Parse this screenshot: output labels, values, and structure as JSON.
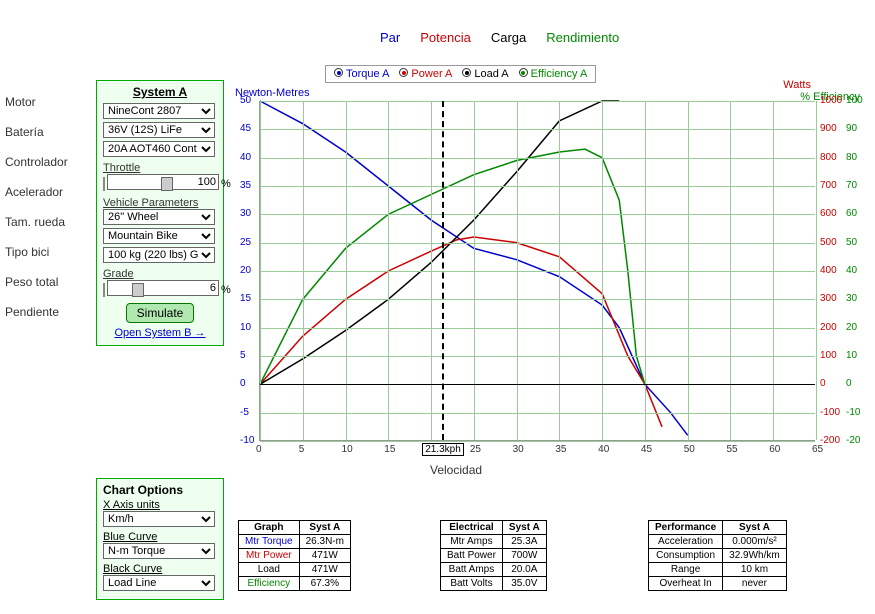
{
  "top": {
    "par": "Par",
    "potencia": "Potencia",
    "carga": "Carga",
    "rend": "Rendimiento"
  },
  "side": {
    "motor": "Motor",
    "bateria": "Batería",
    "control": "Controlador",
    "acel": "Acelerador",
    "rueda": "Tam. rueda",
    "bici": "Tipo bici",
    "peso": "Peso total",
    "pend": "Pendiente"
  },
  "sysA": {
    "title": "System A",
    "motor": "NineCont 2807",
    "battery": "36V (12S) LiFe",
    "controller": "20A AOT460 Cont",
    "throttle_lbl": "Throttle",
    "throttle_val": "100",
    "throttle_pct": "%",
    "veh_lbl": "Vehicle Parameters",
    "wheel": "26\" Wheel",
    "bike": "Mountain Bike",
    "weight": "100 kg (220 lbs) G",
    "grade_lbl": "Grade",
    "grade_val": "6",
    "grade_pct": "%",
    "simulate": "Simulate",
    "openB": "Open System B →"
  },
  "chartopts": {
    "title": "Chart Options",
    "xunits_lbl": "X Axis units",
    "xunits": "Km/h",
    "blue_lbl": "Blue Curve",
    "blue": "N-m Torque",
    "black_lbl": "Black Curve",
    "black": "Load Line"
  },
  "legend": {
    "torque": "Torque A",
    "power": "Power A",
    "load": "Load A",
    "eff": "Efficiency A"
  },
  "axes": {
    "yleft": "Newton-Metres",
    "yright1": "Watts",
    "yright2": "% Efficiency",
    "xlab": "Velocidad",
    "cursor": "21.3kph"
  },
  "chart_data": {
    "type": "line",
    "xlabel": "Velocidad (kph)",
    "xlim": [
      0,
      65
    ],
    "y_left": {
      "label": "Newton-Metres",
      "lim": [
        -10,
        50
      ]
    },
    "y_right_watts": {
      "label": "Watts",
      "lim": [
        -200,
        1000
      ]
    },
    "y_right_eff": {
      "label": "% Efficiency",
      "lim": [
        -20,
        100
      ]
    },
    "cursor_x": 21.3,
    "series": [
      {
        "name": "Torque A",
        "axis": "y_left",
        "color": "#00c",
        "x": [
          0,
          5,
          10,
          15,
          20,
          25,
          30,
          35,
          40,
          42,
          45,
          48,
          50
        ],
        "y": [
          50,
          46,
          41,
          35,
          29,
          24,
          22,
          19,
          14,
          10,
          0,
          -5,
          -9
        ]
      },
      {
        "name": "Power A",
        "axis": "y_right_watts",
        "color": "#c00",
        "x": [
          0,
          5,
          10,
          15,
          20,
          23,
          25,
          30,
          35,
          40,
          43,
          45,
          47
        ],
        "y": [
          0,
          170,
          300,
          400,
          470,
          510,
          520,
          500,
          450,
          320,
          100,
          0,
          -150
        ]
      },
      {
        "name": "Load A",
        "axis": "y_right_watts",
        "color": "#000",
        "x": [
          0,
          5,
          10,
          15,
          20,
          25,
          30,
          35,
          40,
          42
        ],
        "y": [
          0,
          90,
          190,
          300,
          430,
          580,
          750,
          930,
          1000,
          1000
        ]
      },
      {
        "name": "Efficiency A",
        "axis": "y_right_eff",
        "color": "#080",
        "x": [
          0,
          5,
          10,
          15,
          20,
          25,
          30,
          35,
          38,
          40,
          42,
          43,
          44,
          45
        ],
        "y": [
          0,
          30,
          48,
          60,
          67,
          74,
          79,
          82,
          83,
          80,
          65,
          40,
          10,
          0
        ]
      }
    ]
  },
  "tables": {
    "graph": {
      "h1": "Graph",
      "h2": "Syst A",
      "rows": [
        {
          "k": "Mtr Torque",
          "v": "26.3N-m",
          "cls": "row-torque"
        },
        {
          "k": "Mtr Power",
          "v": "471W",
          "cls": "row-power"
        },
        {
          "k": "Load",
          "v": "471W",
          "cls": ""
        },
        {
          "k": "Efficiency",
          "v": "67.3%",
          "cls": "row-eff"
        }
      ]
    },
    "elec": {
      "h1": "Electrical",
      "h2": "Syst A",
      "rows": [
        {
          "k": "Mtr Amps",
          "v": "25.3A"
        },
        {
          "k": "Batt Power",
          "v": "700W"
        },
        {
          "k": "Batt Amps",
          "v": "20.0A"
        },
        {
          "k": "Batt Volts",
          "v": "35.0V"
        }
      ]
    },
    "perf": {
      "h1": "Performance",
      "h2": "Syst A",
      "rows": [
        {
          "k": "Acceleration",
          "v": "0.000m/s²"
        },
        {
          "k": "Consumption",
          "v": "32.9Wh/km"
        },
        {
          "k": "Range",
          "v": "10 km"
        },
        {
          "k": "Overheat In",
          "v": "never"
        }
      ]
    }
  }
}
